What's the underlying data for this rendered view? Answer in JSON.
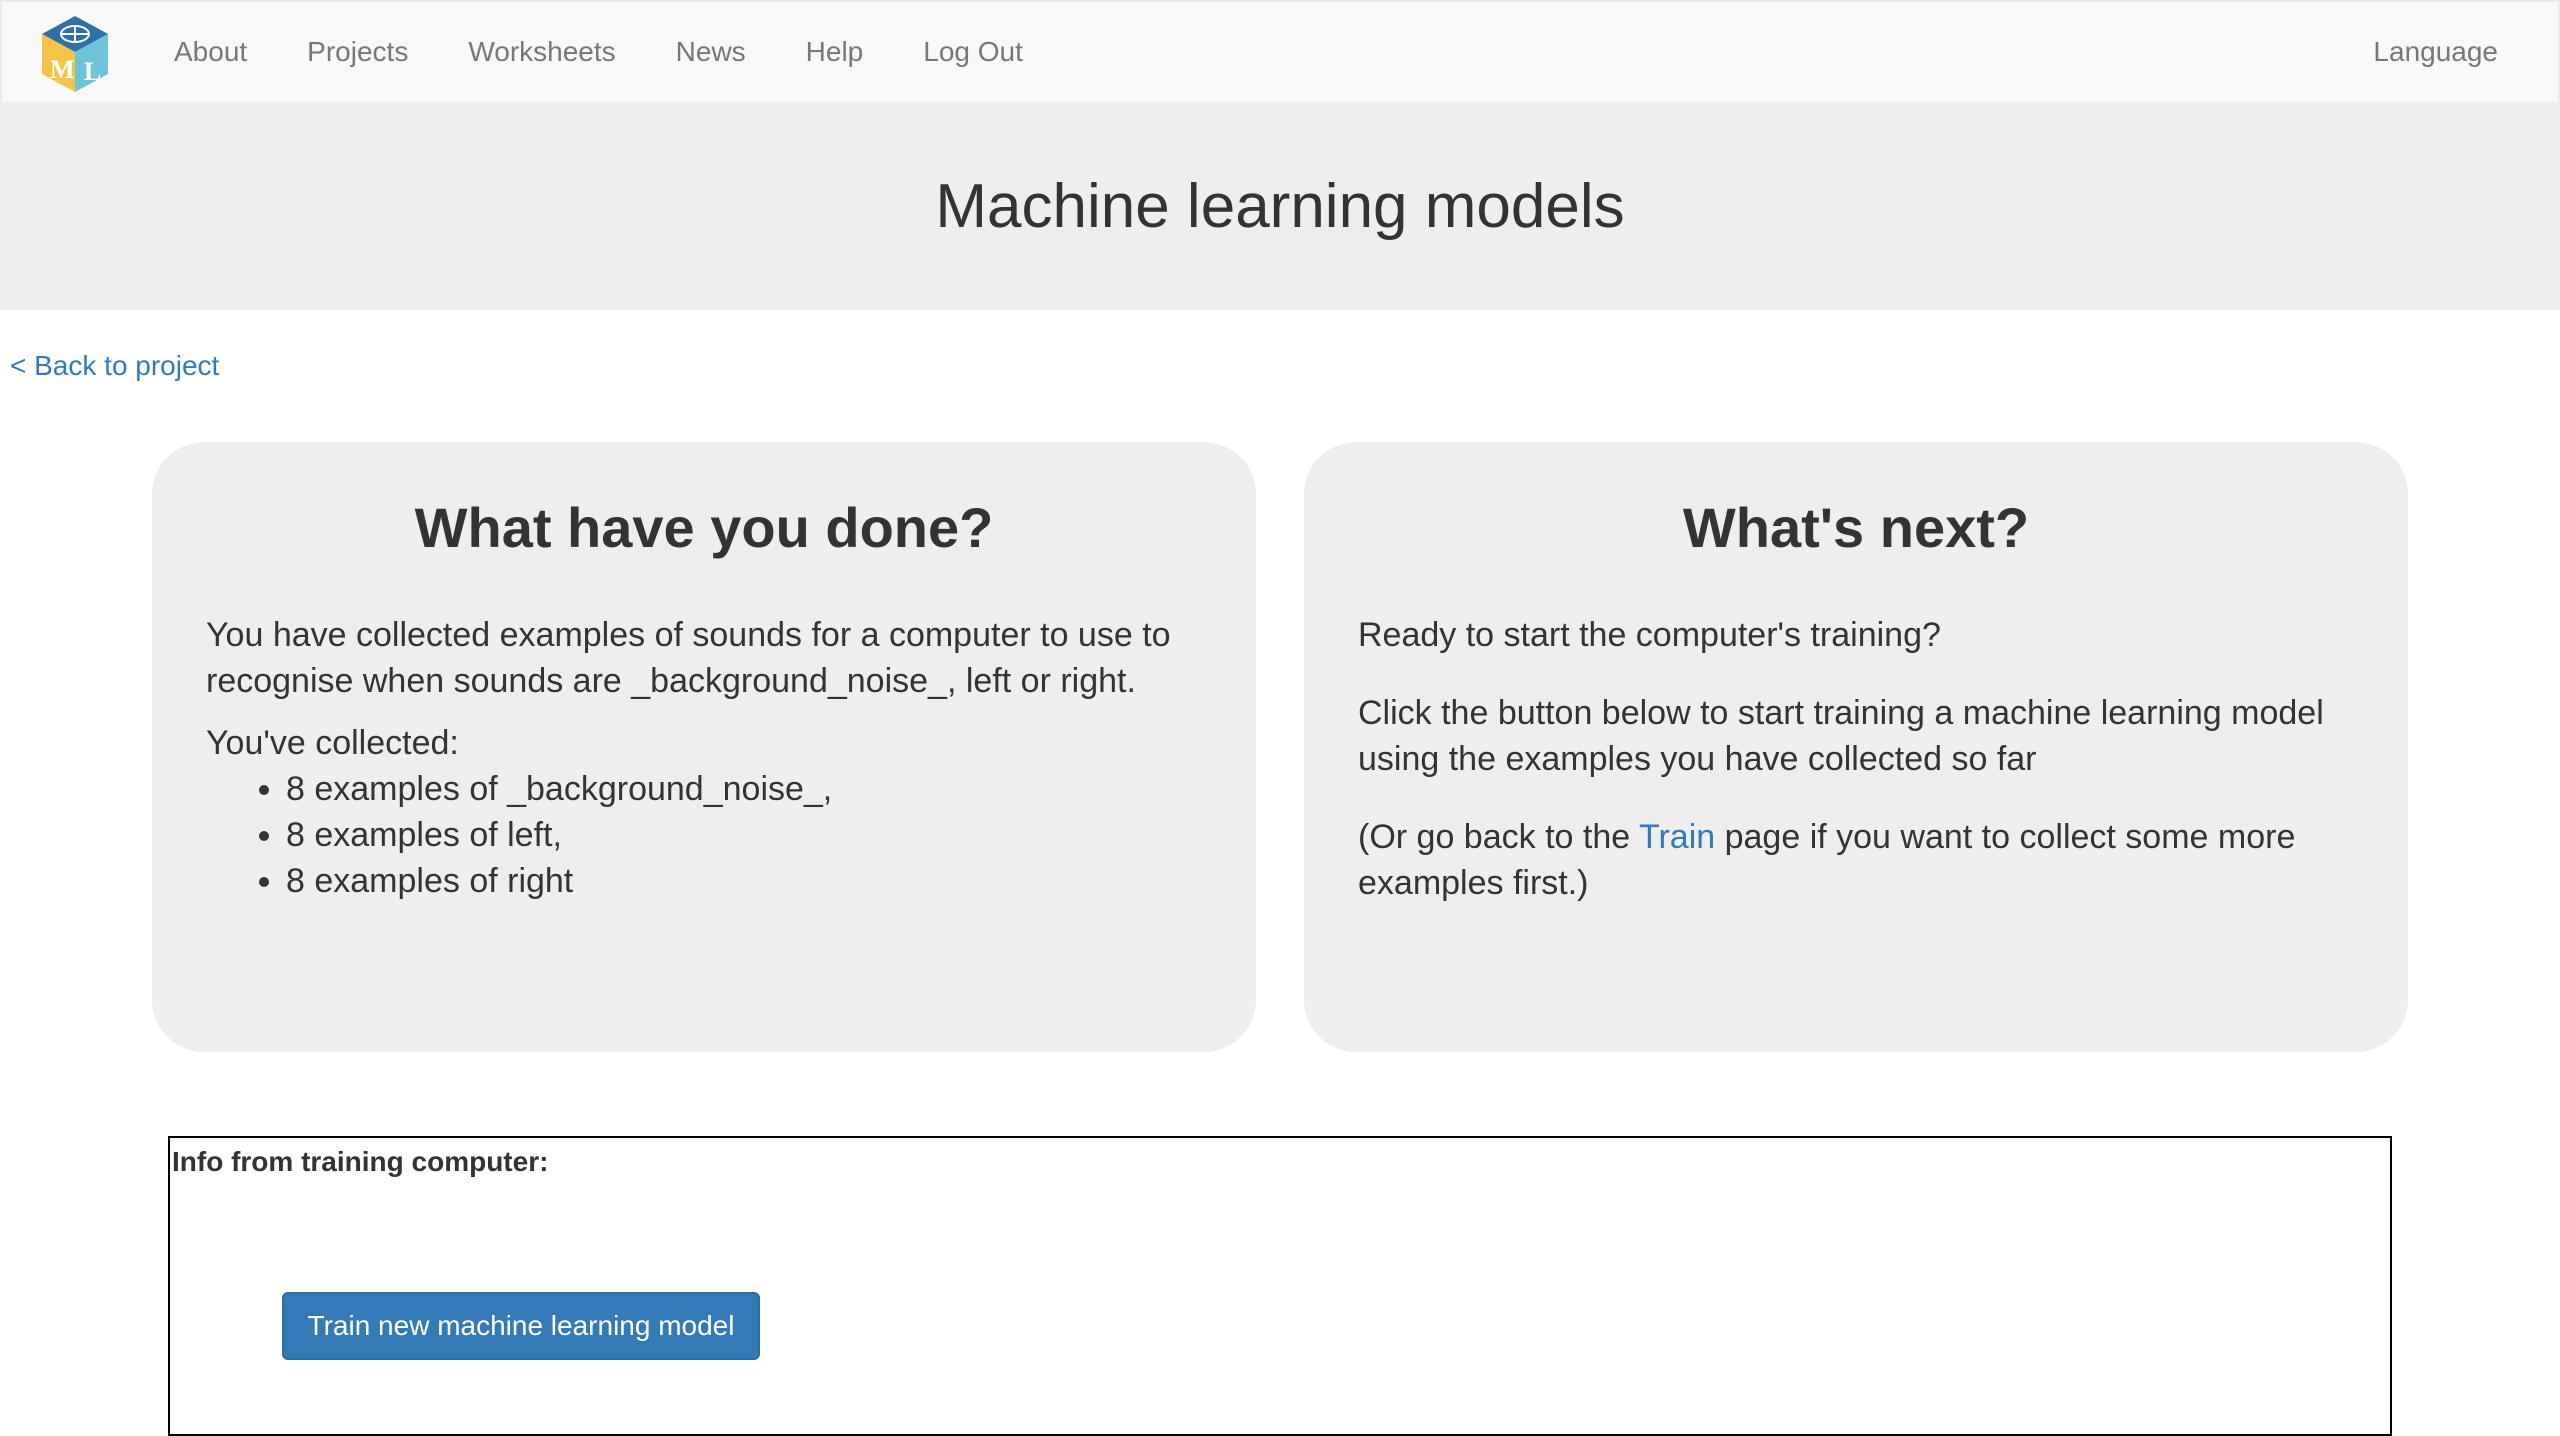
{
  "navbar": {
    "logo_letters": "ML",
    "links": [
      "About",
      "Projects",
      "Worksheets",
      "News",
      "Help",
      "Log Out"
    ],
    "language": "Language"
  },
  "page": {
    "title": "Machine learning models",
    "back_link": "< Back to project"
  },
  "left_panel": {
    "heading": "What have you done?",
    "description": "You have collected examples of sounds for a computer to use to recognise when sounds are _background_noise_, left or right.",
    "collected_label": "You've collected:",
    "items": [
      "8 examples of _background_noise_,",
      "8 examples of left,",
      "8 examples of right"
    ]
  },
  "right_panel": {
    "heading": "What's next?",
    "ready_text": "Ready to start the computer's training?",
    "instruction": "Click the button below to start training a machine learning model using the examples you have collected so far",
    "goback_before": "(Or go back to the ",
    "goback_link": "Train",
    "goback_after": " page if you want to collect some more examples first.)"
  },
  "training": {
    "info_label": "Info from training computer:",
    "button_label": "Train new machine learning model"
  },
  "colors": {
    "link": "#337ab7",
    "button": "#337ab7",
    "panel_bg": "#eeeeee",
    "navbar_bg": "#f8f8f8"
  }
}
